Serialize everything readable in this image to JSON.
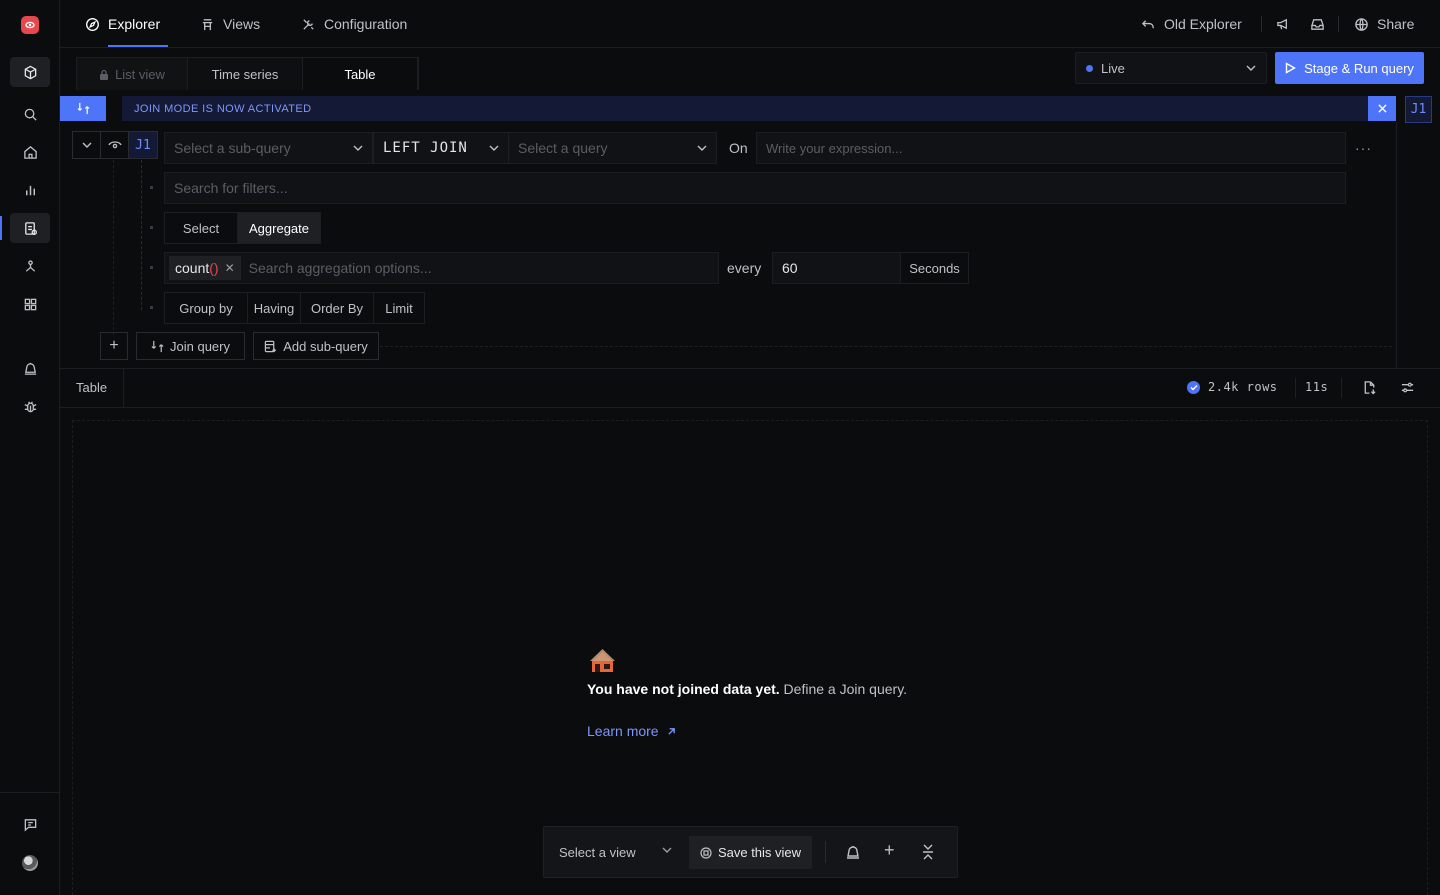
{
  "topnav": {
    "tabs": [
      {
        "label": "Explorer",
        "icon": "compass-icon"
      },
      {
        "label": "Views",
        "icon": "views-icon"
      },
      {
        "label": "Configuration",
        "icon": "config-icon"
      }
    ],
    "old_explorer": "Old Explorer",
    "share": "Share"
  },
  "view_tabs": [
    "List view",
    "Time series",
    "Table"
  ],
  "live_select": {
    "value": "Live"
  },
  "run_button": "Stage & Run query",
  "join_banner": "JOIN MODE IS NOW ACTIVATED",
  "join_badge": "J1",
  "query": {
    "badge": "J1",
    "subquery_placeholder": "Select a sub-query",
    "join_type": "LEFT JOIN",
    "query_placeholder": "Select a query",
    "on_label": "On",
    "expression_placeholder": "Write your expression...",
    "more": "···",
    "filter_placeholder": "Search for filters...",
    "mode_options": [
      "Select",
      "Aggregate"
    ],
    "aggregation": {
      "chip_name": "count",
      "chip_parens": "()",
      "chip_remove": "✕",
      "placeholder": "Search aggregation options..."
    },
    "every_label": "every",
    "interval_value": "60",
    "interval_unit": "Seconds",
    "clauses": [
      "Group by",
      "Having",
      "Order By",
      "Limit"
    ],
    "add_symbol": "+",
    "join_query": "Join query",
    "add_subquery": "Add sub-query"
  },
  "results": {
    "tab": "Table",
    "rows": "2.4k rows",
    "time": "11s"
  },
  "empty_state": {
    "bold": "You have not joined data yet.",
    "text": " Define a Join query.",
    "link": "Learn more"
  },
  "view_bar": {
    "select_label": "Select a view",
    "save_label": "Save this view",
    "add_symbol": "+"
  },
  "colors": {
    "accent": "#4e74f8",
    "background": "#0b0c0e",
    "danger": "#e5484d"
  }
}
